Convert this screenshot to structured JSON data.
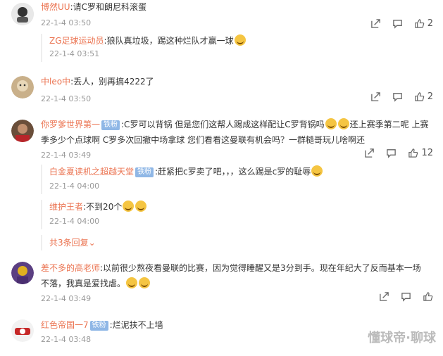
{
  "comments": [
    {
      "user": "博然UU",
      "text": ":请C罗和朗尼科滚蛋",
      "time": "22-1-4 03:50",
      "likes": "2",
      "replies": [
        {
          "user": "ZG足球运动员",
          "text": ":狼队真垃圾，踢这种烂队才赢一球",
          "time": "22-1-4 03:51"
        }
      ]
    },
    {
      "user": "中leo中",
      "text": ":丢人，别再搞4222了",
      "time": "22-1-4 03:50",
      "likes": "2"
    },
    {
      "user": "你罗爹世界第一",
      "badge": "铁粉",
      "text": ":C罗可以背锅 但是您们这帮人踢成这样配让C罗背锅吗",
      "text_cont": "还上赛季第二呢 上赛季多少个点球啊 C罗多次回撤中场拿球 您们看看这曼联有机会吗？一群糙哥玩儿啥啊还",
      "time": "22-1-4 03:49",
      "likes": "12",
      "replies": [
        {
          "user": "白金夏读机之超越天堂",
          "badge": "铁粉",
          "text": ":赶紧把c罗卖了吧，，，这么踢是c罗的耻辱",
          "time": "22-1-4 04:00"
        },
        {
          "user": "维护王者",
          "text": ":不到20个",
          "time": "22-1-4 04:00"
        }
      ],
      "more_replies": "共3条回复"
    },
    {
      "user": "差不多的高老师",
      "text": ":以前很少熬夜看曼联的比赛，因为觉得睡醒又是3分到手。现在年纪大了反而基本一场不落，我真是爱找虐。",
      "time": "22-1-4 03:49"
    },
    {
      "user": "红色帝国一7",
      "badge": "铁粉",
      "text": ":烂泥扶不上墙",
      "time": "22-1-4 03:48"
    }
  ],
  "watermark": "懂球帝·聊球",
  "icons": [
    "share-icon",
    "comment-icon",
    "like-icon"
  ],
  "colors": {
    "username": "#eb7350",
    "badge": "#8fb7e6",
    "meta": "#999999"
  }
}
